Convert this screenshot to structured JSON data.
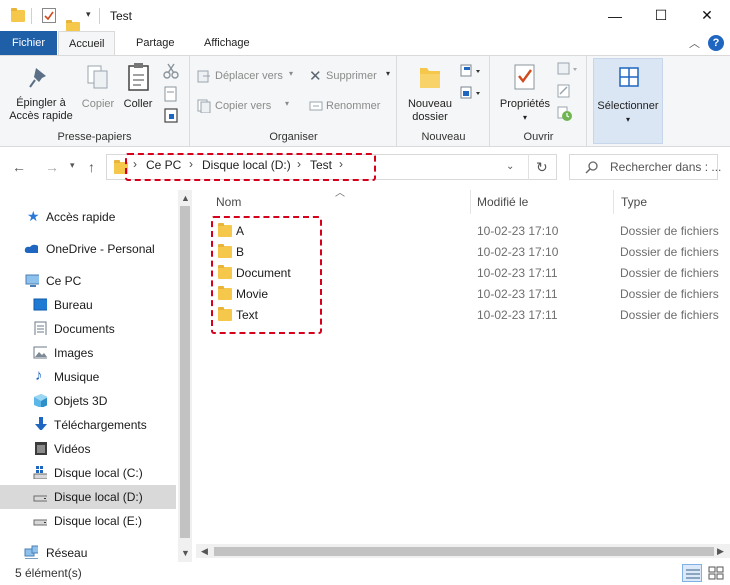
{
  "window": {
    "title": "Test",
    "minimize": "—",
    "maximize": "☐",
    "close": "✕"
  },
  "tabs": [
    {
      "label": "Fichier"
    },
    {
      "label": "Accueil"
    },
    {
      "label": "Partage"
    },
    {
      "label": "Affichage"
    }
  ],
  "ribbon": {
    "groups": {
      "clipboard": "Presse-papiers",
      "organize": "Organiser",
      "new": "Nouveau",
      "open": "Ouvrir"
    },
    "pin_line1": "Épingler à",
    "pin_line2": "Accès rapide",
    "copy": "Copier",
    "paste": "Coller",
    "move_to": "Déplacer vers",
    "copy_to": "Copier vers",
    "delete": "Supprimer",
    "rename": "Renommer",
    "new_folder_line1": "Nouveau",
    "new_folder_line2": "dossier",
    "properties": "Propriétés",
    "select": "Sélectionner"
  },
  "address": {
    "crumbs": [
      "Ce PC",
      "Disque local (D:)",
      "Test"
    ],
    "search_placeholder": "Rechercher dans : ..."
  },
  "nav": {
    "items": [
      {
        "label": "Accès rapide",
        "icon": "star-icon"
      },
      {
        "label": "OneDrive - Personal",
        "icon": "cloud-icon"
      },
      {
        "label": "Ce PC",
        "icon": "computer-icon"
      },
      {
        "label": "Bureau",
        "icon": "desktop-icon"
      },
      {
        "label": "Documents",
        "icon": "documents-icon"
      },
      {
        "label": "Images",
        "icon": "images-icon"
      },
      {
        "label": "Musique",
        "icon": "music-icon"
      },
      {
        "label": "Objets 3D",
        "icon": "cube-icon"
      },
      {
        "label": "Téléchargements",
        "icon": "download-icon"
      },
      {
        "label": "Vidéos",
        "icon": "video-icon"
      },
      {
        "label": "Disque local (C:)",
        "icon": "drive-icon"
      },
      {
        "label": "Disque local (D:)",
        "icon": "drive-icon",
        "selected": true
      },
      {
        "label": "Disque local (E:)",
        "icon": "drive-icon"
      },
      {
        "label": "Réseau",
        "icon": "network-icon"
      }
    ]
  },
  "columns": {
    "name": "Nom",
    "modified": "Modifié le",
    "type": "Type"
  },
  "files": [
    {
      "name": "A",
      "modified": "10-02-23 17:10",
      "type": "Dossier de fichiers"
    },
    {
      "name": "B",
      "modified": "10-02-23 17:10",
      "type": "Dossier de fichiers"
    },
    {
      "name": "Document",
      "modified": "10-02-23 17:11",
      "type": "Dossier de fichiers"
    },
    {
      "name": "Movie",
      "modified": "10-02-23 17:11",
      "type": "Dossier de fichiers"
    },
    {
      "name": "Text",
      "modified": "10-02-23 17:11",
      "type": "Dossier de fichiers"
    }
  ],
  "status": {
    "count": "5 élément(s)"
  },
  "colors": {
    "file_tab": "#1f5fa8",
    "highlight": "#d6001c",
    "folder": "#f5c84c"
  }
}
